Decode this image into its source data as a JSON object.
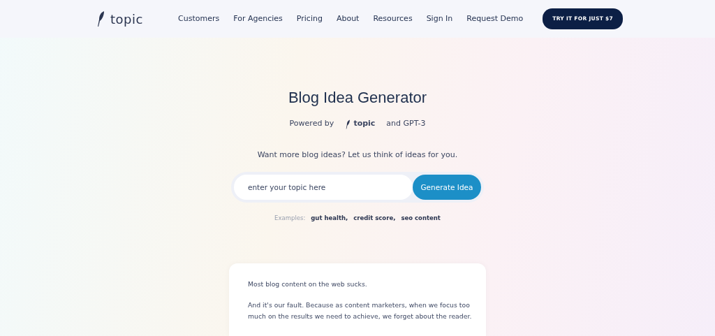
{
  "header": {
    "logo_text": "topic",
    "nav": [
      "Customers",
      "For Agencies",
      "Pricing",
      "About",
      "Resources",
      "Sign In",
      "Request Demo"
    ],
    "cta": "TRY IT FOR JUST $7"
  },
  "hero": {
    "title": "Blog Idea Generator",
    "powered_by": "Powered by",
    "powered_logo": "topic",
    "powered_suffix": "and GPT-3",
    "prompt": "Want more blog ideas? Let us think of ideas for you.",
    "search": {
      "placeholder": "enter your topic here"
    },
    "button": "Generate Idea",
    "examples_label": "Examples:",
    "examples": [
      "gut health,",
      "credit score,",
      "seo content"
    ]
  },
  "card": {
    "paragraphs": [
      "Most blog content on the web sucks.",
      "And it's our fault. Because as content marketers, when we focus too much on the results we need to achieve, we forget about the reader."
    ]
  }
}
